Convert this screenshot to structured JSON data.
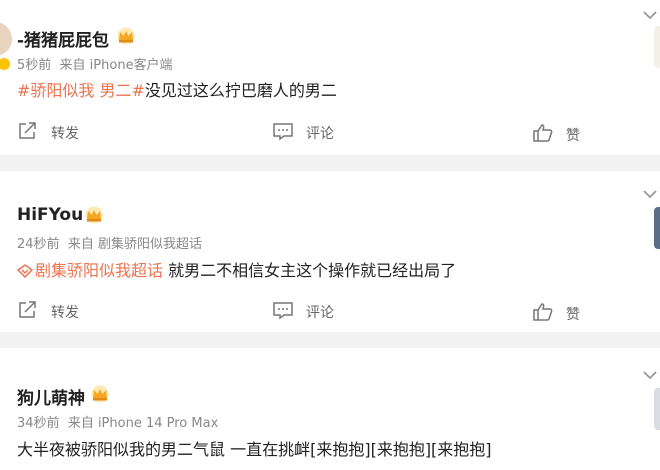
{
  "posts": [
    {
      "username": "-猪猪屁屁包",
      "time": "5秒前",
      "source": "来自 iPhone客户端",
      "tag": "#骄阳似我 男二#",
      "text": "没见过这么拧巴磨人的男二",
      "actions": {
        "repost": "转发",
        "comment": "评论",
        "like": "赞"
      }
    },
    {
      "username": "HiFYou",
      "time": "24秒前",
      "source": "来自 剧集骄阳似我超话",
      "tag": "剧集骄阳似我超话",
      "text": " 就男二不相信女主这个操作就已经出局了",
      "actions": {
        "repost": "转发",
        "comment": "评论",
        "like": "赞"
      }
    },
    {
      "username": "狗儿萌神",
      "time": "34秒前",
      "source": "来自 iPhone 14 Pro Max",
      "text": "大半夜被骄阳似我的男二气鼠 一直在挑衅[来抱抱][来抱抱][来抱抱]"
    }
  ],
  "colors": {
    "accent": "#eb7350",
    "separator": "#f2f2f2",
    "badge": "#ffc400"
  },
  "icons": [
    "crown-icon",
    "repost-icon",
    "comment-icon",
    "like-icon",
    "super-topic-icon",
    "chevron-down-icon"
  ]
}
